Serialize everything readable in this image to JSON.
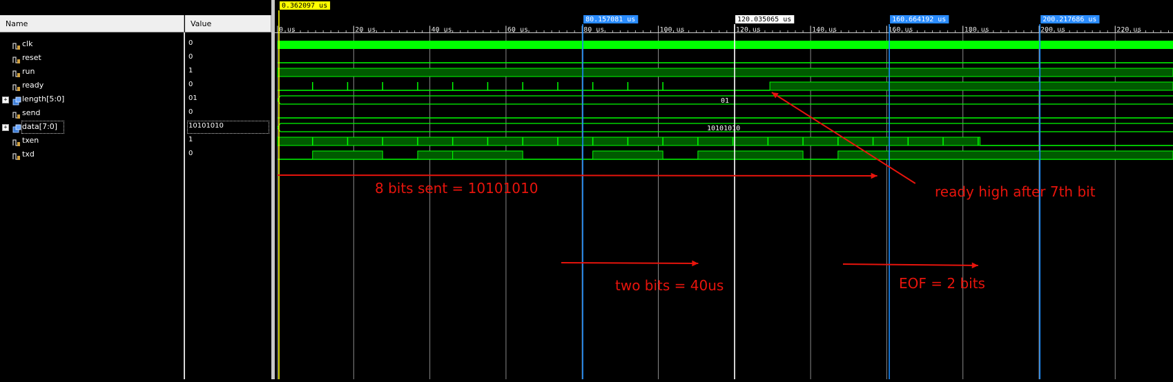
{
  "columns": {
    "name": "Name",
    "value": "Value"
  },
  "signals": [
    {
      "name": "clk",
      "value": "0",
      "type": "bit"
    },
    {
      "name": "reset",
      "value": "0",
      "type": "bit"
    },
    {
      "name": "run",
      "value": "1",
      "type": "bit"
    },
    {
      "name": "ready",
      "value": "0",
      "type": "bit"
    },
    {
      "name": "length[5:0]",
      "value": "01",
      "type": "bus",
      "expander": "+"
    },
    {
      "name": "send",
      "value": "0",
      "type": "bit"
    },
    {
      "name": "data[7:0]",
      "value": "10101010",
      "type": "bus",
      "expander": "+"
    },
    {
      "name": "txen",
      "value": "1",
      "type": "bit"
    },
    {
      "name": "txd",
      "value": "0",
      "type": "bit"
    }
  ],
  "bus_values": {
    "length": "01",
    "data": "10101010"
  },
  "cursors": {
    "main": "0.362097 us",
    "c1": "80.157081 us",
    "c2": "120.035065 us",
    "c3": "160.664192 us",
    "c4": "200.217686 us"
  },
  "time_axis": {
    "labels": [
      "0 us",
      "20 us",
      "40 us",
      "60 us",
      "80 us",
      "100 us",
      "120 us",
      "140 us",
      "160 us",
      "180 us",
      "200 us",
      "220 us"
    ],
    "start_us": 0,
    "major_step_us": 20,
    "minor_per_major": 10
  },
  "annotations": {
    "bits_sent": "8 bits sent  = 10101010",
    "ready_high": "ready high after 7th bit",
    "two_bits": "two bits = 40us",
    "eof": "EOF = 2 bits"
  },
  "colors": {
    "wave": "#00ff00",
    "bus_fill": "#005a00",
    "cursor_main": "#ffff00",
    "cursor_blue": "#1a8cff",
    "annotation": "#e8140c",
    "background": "#000000"
  },
  "icons": [
    "bit-signal-icon",
    "bus-signal-icon",
    "expand-plus-icon"
  ]
}
